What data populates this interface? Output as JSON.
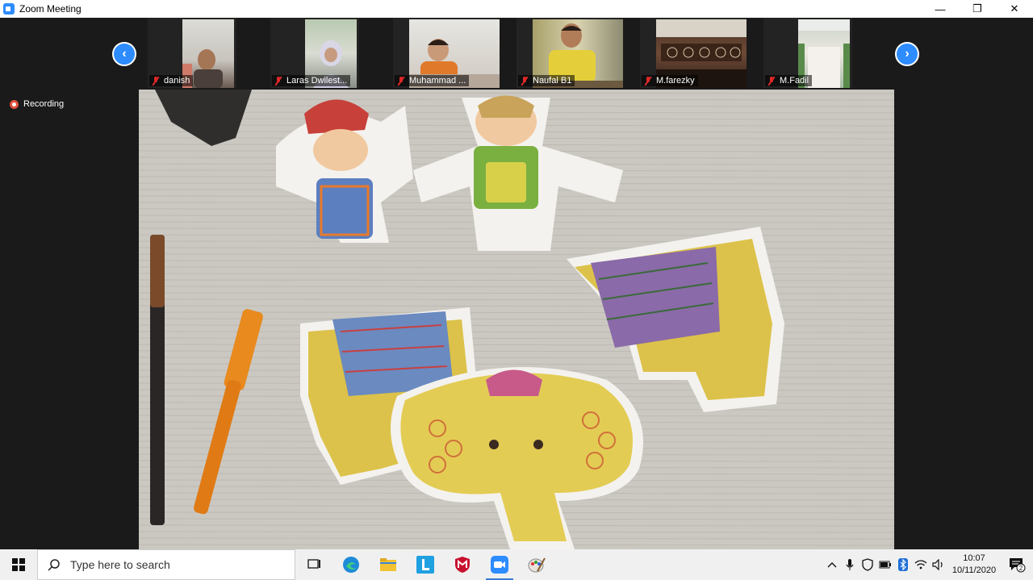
{
  "window": {
    "title": "Zoom Meeting",
    "controls": {
      "minimize": "—",
      "restore": "❐",
      "close": "✕"
    }
  },
  "meeting": {
    "recording_label": "Recording",
    "participants": [
      {
        "name": "danish"
      },
      {
        "name": "Laras Dwilest..."
      },
      {
        "name": "Muhammad ..."
      },
      {
        "name": "Naufal B1"
      },
      {
        "name": "M.farezky"
      },
      {
        "name": "M.Fadil"
      }
    ],
    "nav": {
      "prev": "‹",
      "next": "›"
    }
  },
  "taskbar": {
    "search_placeholder": "Type here to search",
    "pinned": [
      "task-view-icon",
      "edge-icon",
      "file-explorer-icon",
      "l-app-icon",
      "mcafee-icon",
      "zoom-icon",
      "paint-icon"
    ],
    "clock_time": "10:07",
    "clock_date": "10/11/2020",
    "notification_count": "2"
  },
  "colors": {
    "zoom_blue": "#2d8cff",
    "mic_muted": "#e02828",
    "background": "#1a1a1a"
  }
}
